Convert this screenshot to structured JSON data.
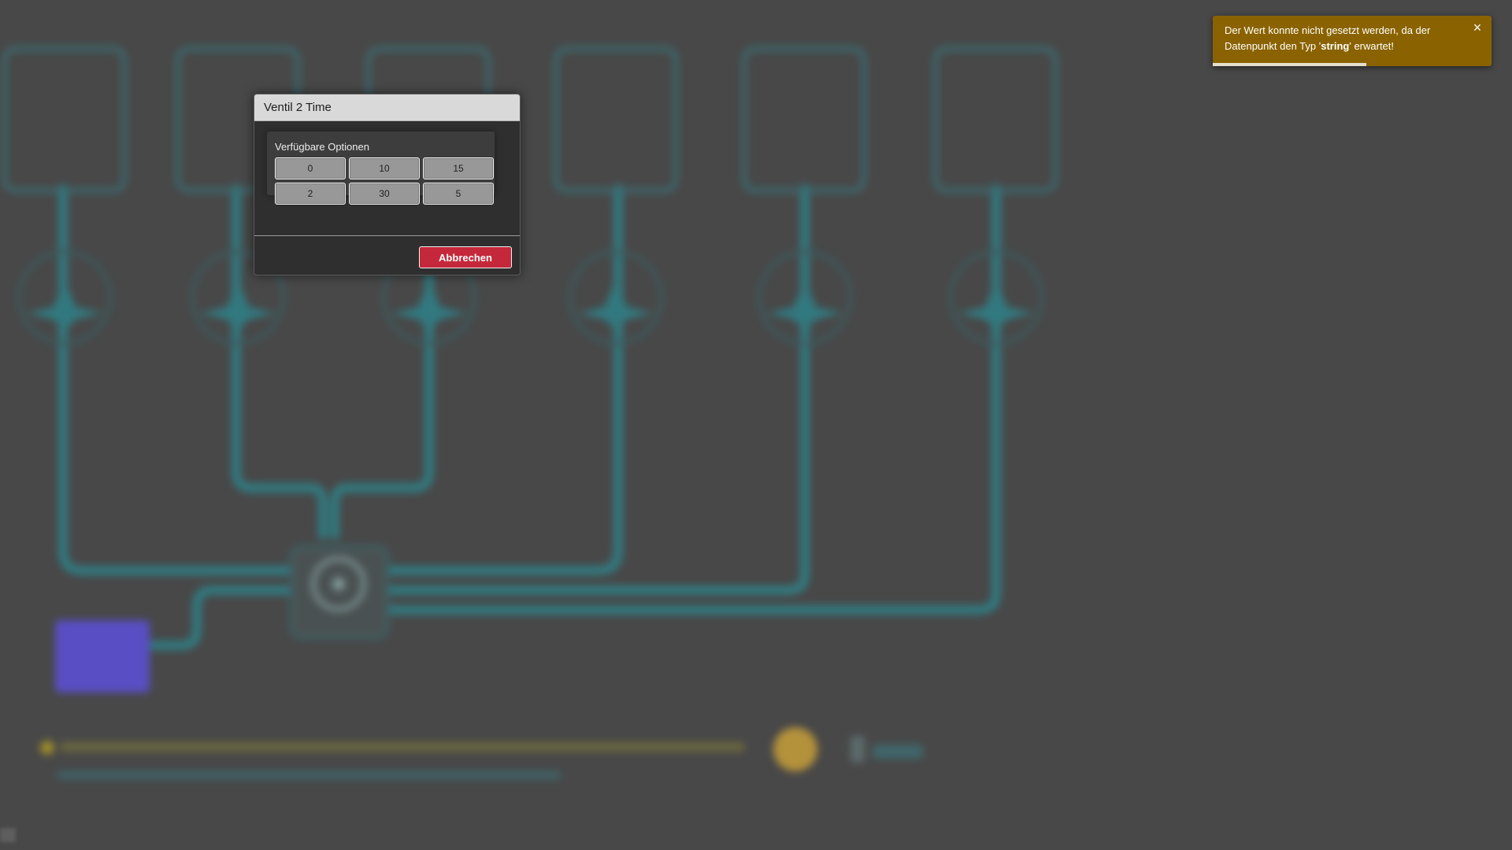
{
  "dialog": {
    "title": "Ventil 2 Time",
    "options_label": "Verfügbare Optionen",
    "options": [
      "0",
      "10",
      "15",
      "2",
      "30",
      "5"
    ],
    "cancel_label": "Abbrechen"
  },
  "toast": {
    "text_before": "Der Wert konnte nicht gesetzt werden, da der Datenpunkt den Typ '",
    "type_name": "string",
    "text_after": "' erwartet!",
    "close_label": "×",
    "progress_pct": 55
  },
  "colors": {
    "pipe": "#2f7f86",
    "tank": "#5b4fd1",
    "toast_bg": "#8a6300",
    "cancel_bg": "#c4283a"
  }
}
